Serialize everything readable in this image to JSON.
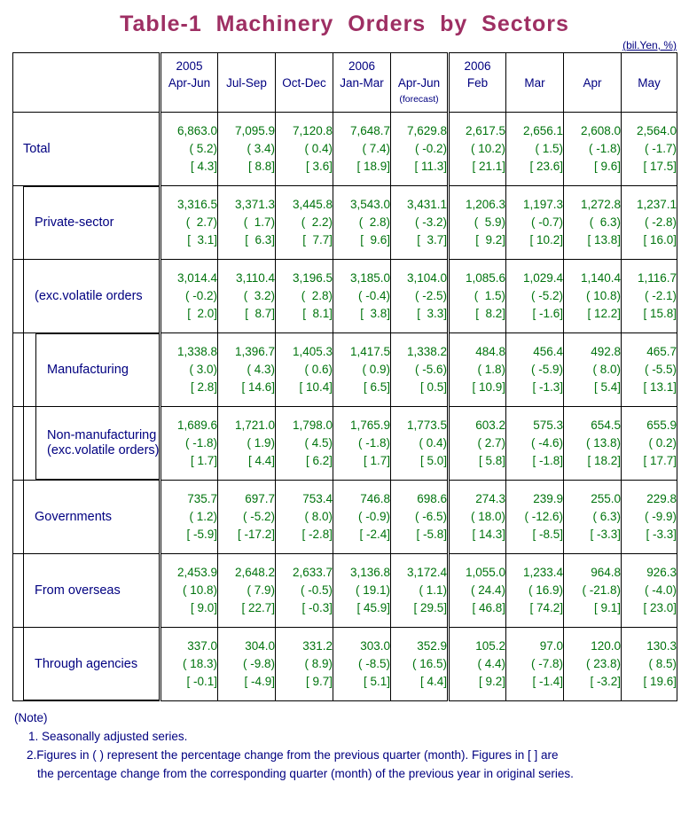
{
  "title": "Table-1  Machinery  Orders  by  Sectors",
  "unit": "(bil.Yen, %)",
  "colors": {
    "title": "#9e2f63",
    "label": "#000080",
    "value": "#00740d",
    "border": "#000000",
    "background": "#ffffff"
  },
  "header": {
    "corner": "",
    "columns": [
      {
        "year": "2005",
        "period": "Apr-Jun",
        "note": ""
      },
      {
        "year": "",
        "period": "Jul-Sep",
        "note": ""
      },
      {
        "year": "",
        "period": "Oct-Dec",
        "note": ""
      },
      {
        "year": "2006",
        "period": "Jan-Mar",
        "note": ""
      },
      {
        "year": "",
        "period": "Apr-Jun",
        "note": "(forecast)"
      },
      {
        "year": "2006",
        "period": "Feb",
        "note": ""
      },
      {
        "year": "",
        "period": "Mar",
        "note": ""
      },
      {
        "year": "",
        "period": "Apr",
        "note": ""
      },
      {
        "year": "",
        "period": "May",
        "note": ""
      }
    ]
  },
  "rows": [
    {
      "label": "Total",
      "label2": "",
      "indent": 0,
      "level": "total",
      "values": [
        "6,863.0",
        "7,095.9",
        "7,120.8",
        "7,648.7",
        "7,629.8",
        "2,617.5",
        "2,656.1",
        "2,608.0",
        "2,564.0"
      ],
      "qoq": [
        "( 5.2)",
        "( 3.4)",
        "( 0.4)",
        "( 7.4)",
        "( -0.2)",
        "( 10.2)",
        "( 1.5)",
        "( -1.8)",
        "( -1.7)"
      ],
      "yoy": [
        "[ 4.3]",
        "[ 8.8]",
        "[ 3.6]",
        "[ 18.9]",
        "[ 11.3]",
        "[ 21.1]",
        "[ 23.6]",
        "[ 9.6]",
        "[ 17.5]"
      ]
    },
    {
      "label": "Private-sector",
      "label2": "",
      "indent": 1,
      "level": "sub",
      "values": [
        "3,316.5",
        "3,371.3",
        "3,445.8",
        "3,543.0",
        "3,431.1",
        "1,206.3",
        "1,197.3",
        "1,272.8",
        "1,237.1"
      ],
      "qoq": [
        "(  2.7)",
        "(  1.7)",
        "(  2.2)",
        "(  2.8)",
        "( -3.2)",
        "(  5.9)",
        "( -0.7)",
        "(  6.3)",
        "( -2.8)"
      ],
      "yoy": [
        "[  3.1]",
        "[  6.3]",
        "[  7.7]",
        "[  9.6]",
        "[  3.7]",
        "[  9.2]",
        "[ 10.2]",
        "[ 13.8]",
        "[ 16.0]"
      ]
    },
    {
      "label": "(exc.volatile orders",
      "label2": "",
      "indent": 1,
      "level": "sub",
      "values": [
        "3,014.4",
        "3,110.4",
        "3,196.5",
        "3,185.0",
        "3,104.0",
        "1,085.6",
        "1,029.4",
        "1,140.4",
        "1,116.7"
      ],
      "qoq": [
        "( -0.2)",
        "(  3.2)",
        "(  2.8)",
        "( -0.4)",
        "( -2.5)",
        "(  1.5)",
        "( -5.2)",
        "( 10.8)",
        "( -2.1)"
      ],
      "yoy": [
        "[  2.0]",
        "[  8.7]",
        "[  8.1]",
        "[  3.8]",
        "[  3.3]",
        "[  8.2]",
        "[ -1.6]",
        "[ 12.2]",
        "[ 15.8]"
      ]
    },
    {
      "label": "Manufacturing",
      "label2": "",
      "indent": 2,
      "level": "subsub",
      "values": [
        "1,338.8",
        "1,396.7",
        "1,405.3",
        "1,417.5",
        "1,338.2",
        "484.8",
        "456.4",
        "492.8",
        "465.7"
      ],
      "qoq": [
        "( 3.0)",
        "( 4.3)",
        "( 0.6)",
        "( 0.9)",
        "( -5.6)",
        "( 1.8)",
        "( -5.9)",
        "( 8.0)",
        "( -5.5)"
      ],
      "yoy": [
        "[ 2.8]",
        "[ 14.6]",
        "[ 10.4]",
        "[ 6.5]",
        "[ 0.5]",
        "[ 10.9]",
        "[ -1.3]",
        "[ 5.4]",
        "[ 13.1]"
      ]
    },
    {
      "label": "Non-manufacturing",
      "label2": "(exc.volatile orders)",
      "indent": 2,
      "level": "subsub",
      "values": [
        "1,689.6",
        "1,721.0",
        "1,798.0",
        "1,765.9",
        "1,773.5",
        "603.2",
        "575.3",
        "654.5",
        "655.9"
      ],
      "qoq": [
        "( -1.8)",
        "( 1.9)",
        "( 4.5)",
        "( -1.8)",
        "( 0.4)",
        "( 2.7)",
        "( -4.6)",
        "( 13.8)",
        "( 0.2)"
      ],
      "yoy": [
        "[ 1.7]",
        "[ 4.4]",
        "[ 6.2]",
        "[ 1.7]",
        "[ 5.0]",
        "[ 5.8]",
        "[ -1.8]",
        "[ 18.2]",
        "[ 17.7]"
      ]
    },
    {
      "label": "Governments",
      "label2": "",
      "indent": 1,
      "level": "sub",
      "values": [
        "735.7",
        "697.7",
        "753.4",
        "746.8",
        "698.6",
        "274.3",
        "239.9",
        "255.0",
        "229.8"
      ],
      "qoq": [
        "( 1.2)",
        "( -5.2)",
        "( 8.0)",
        "( -0.9)",
        "( -6.5)",
        "( 18.0)",
        "( -12.6)",
        "( 6.3)",
        "( -9.9)"
      ],
      "yoy": [
        "[ -5.9]",
        "[ -17.2]",
        "[ -2.8]",
        "[ -2.4]",
        "[ -5.8]",
        "[ 14.3]",
        "[ -8.5]",
        "[ -3.3]",
        "[ -3.3]"
      ]
    },
    {
      "label": "From overseas",
      "label2": "",
      "indent": 1,
      "level": "sub",
      "values": [
        "2,453.9",
        "2,648.2",
        "2,633.7",
        "3,136.8",
        "3,172.4",
        "1,055.0",
        "1,233.4",
        "964.8",
        "926.3"
      ],
      "qoq": [
        "( 10.8)",
        "( 7.9)",
        "( -0.5)",
        "( 19.1)",
        "( 1.1)",
        "( 24.4)",
        "( 16.9)",
        "( -21.8)",
        "( -4.0)"
      ],
      "yoy": [
        "[ 9.0]",
        "[ 22.7]",
        "[ -0.3]",
        "[ 45.9]",
        "[ 29.5]",
        "[ 46.8]",
        "[ 74.2]",
        "[ 9.1]",
        "[ 23.0]"
      ]
    },
    {
      "label": "Through agencies",
      "label2": "",
      "indent": 1,
      "level": "sub",
      "values": [
        "337.0",
        "304.0",
        "331.2",
        "303.0",
        "352.9",
        "105.2",
        "97.0",
        "120.0",
        "130.3"
      ],
      "qoq": [
        "( 18.3)",
        "( -9.8)",
        "( 8.9)",
        "( -8.5)",
        "( 16.5)",
        "( 4.4)",
        "( -7.8)",
        "( 23.8)",
        "( 8.5)"
      ],
      "yoy": [
        "[ -0.1]",
        "[ -4.9]",
        "[ 9.7]",
        "[ 5.1]",
        "[ 4.4]",
        "[ 9.2]",
        "[ -1.4]",
        "[ -3.2]",
        "[ 19.6]"
      ]
    }
  ],
  "notes": {
    "heading": "(Note)",
    "line1": "1. Seasonally adjusted series.",
    "line2a": "2.Figures in ( ) represent the percentage change from the previous quarter (month). Figures in [ ] are",
    "line2b": "the percentage change from the corresponding quarter (month) of the previous year in original series."
  }
}
